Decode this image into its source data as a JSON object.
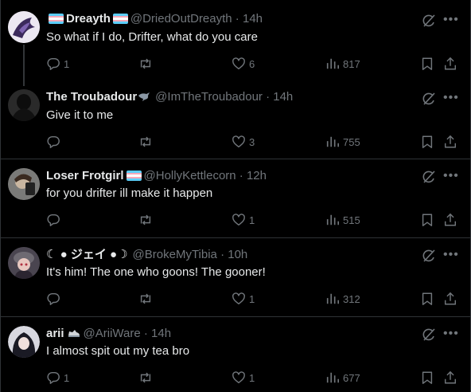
{
  "tweets": [
    {
      "name": "Dreayth",
      "handle": "@DriedOutDreayth",
      "time": "14h",
      "text": "So what if I do, Drifter, what do you care",
      "replies": "1",
      "reposts": "",
      "likes": "6",
      "views": "817"
    },
    {
      "name": "The Troubadour",
      "handle": "@ImTheTroubadour",
      "time": "14h",
      "text": "Give it to me",
      "replies": "",
      "reposts": "",
      "likes": "3",
      "views": "755"
    },
    {
      "name": "Loser Frotgirl",
      "handle": "@HollyKettlecorn",
      "time": "12h",
      "text": "for you drifter ill make it happen",
      "replies": "",
      "reposts": "",
      "likes": "1",
      "views": "515"
    },
    {
      "name": "☾ ● ジェイ ●☽",
      "handle": "@BrokeMyTibia",
      "time": "10h",
      "text": "It's him! The one who goons! The gooner!",
      "replies": "",
      "reposts": "",
      "likes": "1",
      "views": "312"
    },
    {
      "name": "arii",
      "handle": "@AriiWare",
      "time": "14h",
      "text": "I almost spit out my tea bro",
      "replies": "1",
      "reposts": "",
      "likes": "1",
      "views": "677"
    }
  ],
  "separator": " · ",
  "icons": {
    "reply": "reply-icon",
    "repost": "repost-icon",
    "like": "heart-icon",
    "views": "views-icon",
    "bookmark": "bookmark-icon",
    "share": "share-icon",
    "grok": "grok-icon",
    "more": "more-icon",
    "trans_flag": "trans-flag-icon",
    "crow": "crow-icon",
    "sneaker": "sneaker-icon"
  },
  "colors": {
    "background": "#000000",
    "text": "#e7e9ea",
    "secondary": "#71767b",
    "divider": "#2f3336",
    "flag_blue": "#5bcefa",
    "flag_pink": "#f5a9b8",
    "flag_white": "#ffffff"
  }
}
